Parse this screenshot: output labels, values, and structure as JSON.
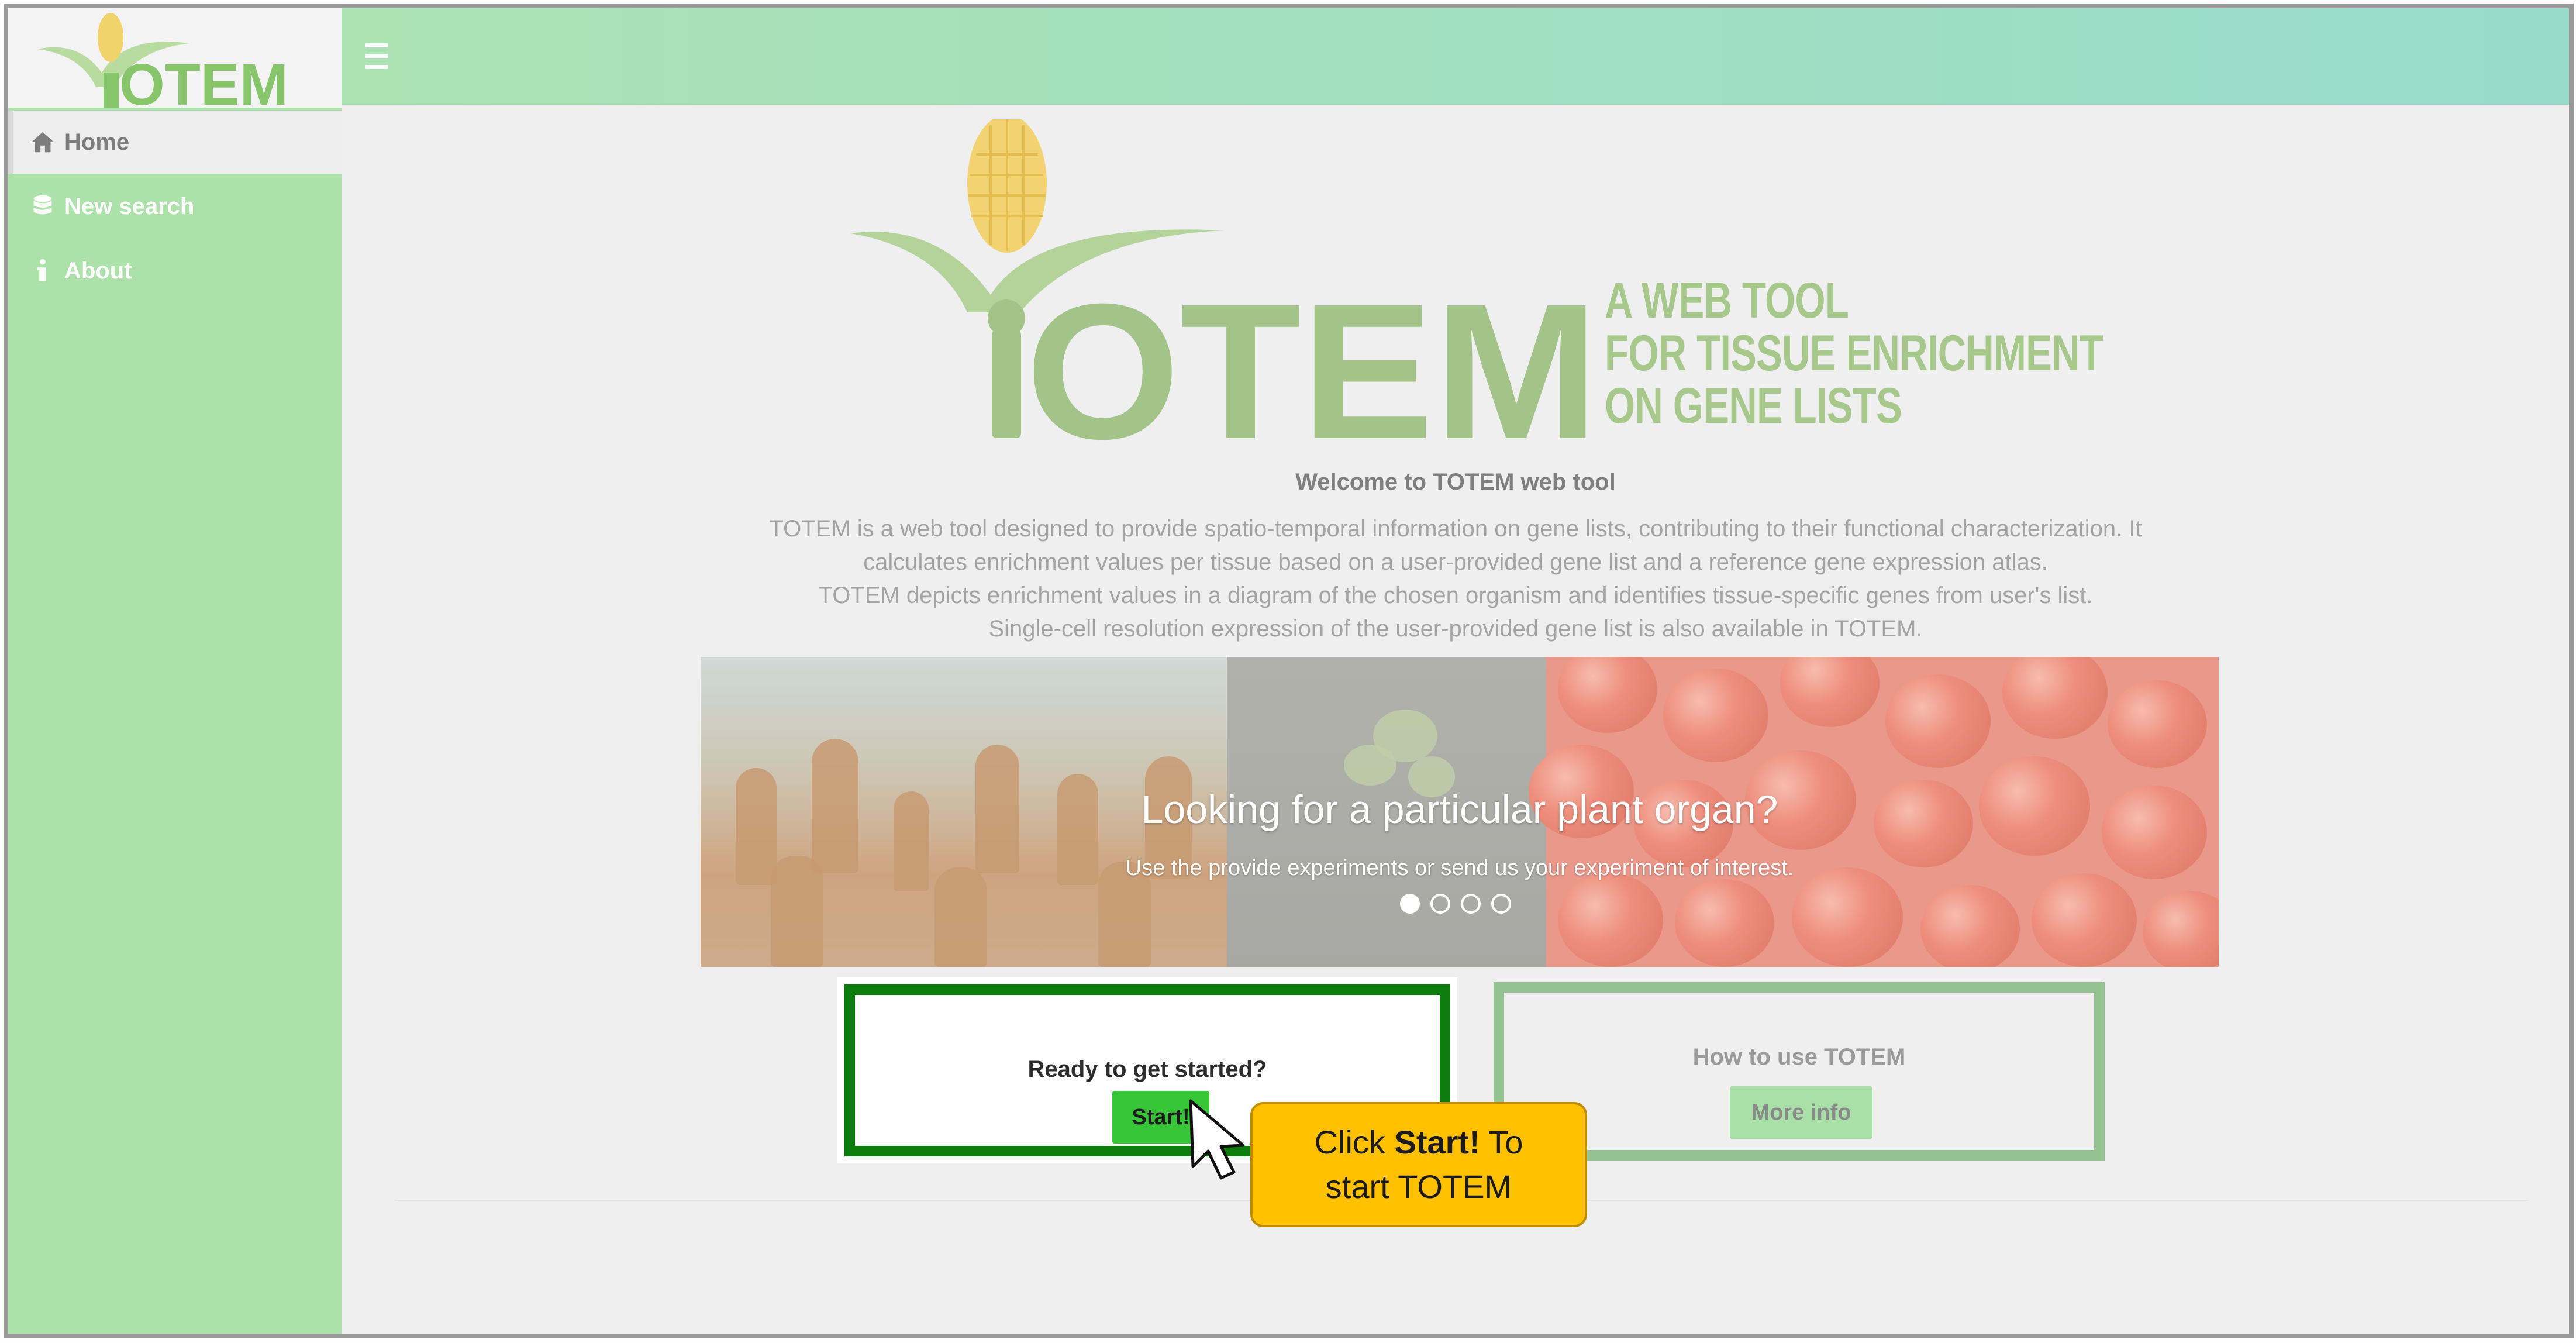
{
  "app": {
    "logo_text": "TOTEM"
  },
  "sidebar": {
    "items": [
      {
        "label": "Home",
        "icon": "home-icon",
        "active": true
      },
      {
        "label": "New search",
        "icon": "database-icon",
        "active": false
      },
      {
        "label": "About",
        "icon": "info-icon",
        "active": false
      }
    ]
  },
  "header": {
    "menu_icon": "hamburger-icon"
  },
  "hero": {
    "logo_text": "TOTEM",
    "tagline": [
      "A WEB TOOL",
      "FOR TISSUE ENRICHMENT",
      "ON GENE LISTS"
    ]
  },
  "welcome": {
    "title": "Welcome to TOTEM web tool",
    "lines": [
      "TOTEM is a web tool designed to provide spatio-temporal information on gene lists, contributing to their functional characterization. It",
      "calculates enrichment values per tissue based on a user-provided gene list and a reference gene expression atlas.",
      "TOTEM depicts enrichment values in a diagram of the chosen organism and identifies tissue-specific genes from user's list.",
      "Single-cell resolution expression of the user-provided gene list is also available in TOTEM."
    ]
  },
  "carousel": {
    "title": "Looking for a particular plant organ?",
    "subtitle": "Use the provide experiments or send us your experiment of interest.",
    "active_slide": 1,
    "slide_count": 4
  },
  "cards": {
    "start": {
      "question": "Ready to get started?",
      "button": "Start!"
    },
    "info": {
      "question": "How to use TOTEM",
      "button": "More info"
    }
  },
  "callout": {
    "prefix": "Click ",
    "bold": "Start!",
    "suffix": " To",
    "line2": "start TOTEM"
  },
  "colors": {
    "sidebar": "#ace2aa",
    "accent_green": "#0c7c0c",
    "start_button": "#36c637",
    "callout": "#ffc000",
    "logo_green": "#a6c88a"
  }
}
